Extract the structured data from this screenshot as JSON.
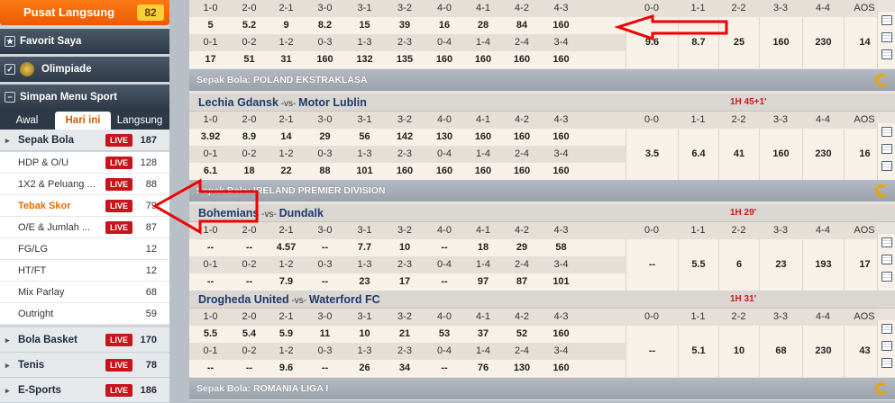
{
  "sidebar": {
    "live_label": "Pusat Langsung",
    "live_count": "82",
    "favorit": "Favorit Saya",
    "olimpiade": "Olimpiade",
    "simpan": "Simpan Menu Sport",
    "tabs": [
      "Awal",
      "Hari ini",
      "Langsung"
    ],
    "live_badge": "LIVE",
    "sports_top": {
      "label": "Sepak Bola",
      "count": "187"
    },
    "subs": [
      {
        "label": "HDP & O/U",
        "count": "128",
        "live": true
      },
      {
        "label": "1X2 & Peluang ...",
        "count": "88",
        "live": true
      },
      {
        "label": "Tebak Skor",
        "count": "79",
        "live": true
      },
      {
        "label": "O/E & Jumlah ...",
        "count": "87",
        "live": true
      },
      {
        "label": "FG/LG",
        "count": "12",
        "live": false
      },
      {
        "label": "HT/FT",
        "count": "12",
        "live": false
      },
      {
        "label": "Mix Parlay",
        "count": "68",
        "live": false
      },
      {
        "label": "Outright",
        "count": "59",
        "live": false
      }
    ],
    "sports_bottom": [
      {
        "label": "Bola Basket",
        "count": "170"
      },
      {
        "label": "Tenis",
        "count": "78"
      },
      {
        "label": "E-Sports",
        "count": "186"
      }
    ]
  },
  "score_headers": {
    "left": [
      "1-0",
      "2-0",
      "2-1",
      "3-0",
      "3-1",
      "3-2",
      "4-0",
      "4-1",
      "4-2",
      "4-3"
    ],
    "left_rev": [
      "0-1",
      "0-2",
      "1-2",
      "0-3",
      "1-3",
      "2-3",
      "0-4",
      "1-4",
      "2-4",
      "3-4"
    ],
    "right": [
      "0-0",
      "1-1",
      "2-2",
      "3-3",
      "4-4",
      "AOS"
    ]
  },
  "top_partial": {
    "rows": [
      [
        "5",
        "5.2",
        "9",
        "8.2",
        "15",
        "39",
        "16",
        "28",
        "84",
        "160"
      ],
      [
        "17",
        "51",
        "31",
        "160",
        "132",
        "135",
        "160",
        "160",
        "160",
        "160"
      ]
    ],
    "right": [
      "9.6",
      "8.7",
      "25",
      "160",
      "230",
      "14"
    ]
  },
  "leagues": [
    {
      "label": "Sepak Bola: POLAND EKSTRAKLASA"
    },
    {
      "label": "Sepak Bola: IRELAND PREMIER DIVISION"
    },
    {
      "label": "Sepak Bola: ROMANIA LIGA I"
    }
  ],
  "matches": [
    {
      "home": "Lechia Gdansk",
      "vs": "-vs-",
      "away": "Motor Lublin",
      "time": "1H 45+1'",
      "row1": [
        "3.92",
        "8.9",
        "14",
        "29",
        "56",
        "142",
        "130",
        "160",
        "160",
        "160"
      ],
      "row2": [
        "6.1",
        "18",
        "22",
        "88",
        "101",
        "160",
        "160",
        "160",
        "160",
        "160"
      ],
      "right": [
        "3.5",
        "6.4",
        "41",
        "160",
        "230",
        "16"
      ]
    },
    {
      "home": "Bohemians",
      "vs": "-vs-",
      "away": "Dundalk",
      "time": "1H 29'",
      "row1": [
        "--",
        "--",
        "4.57",
        "--",
        "7.7",
        "10",
        "--",
        "18",
        "29",
        "58"
      ],
      "row2": [
        "--",
        "--",
        "7.9",
        "--",
        "23",
        "17",
        "--",
        "97",
        "87",
        "101"
      ],
      "right": [
        "--",
        "5.5",
        "6",
        "23",
        "193",
        "17"
      ]
    },
    {
      "home": "Drogheda United",
      "vs": "-vs-",
      "away": "Waterford FC",
      "time": "1H 31'",
      "row1": [
        "5.5",
        "5.4",
        "5.9",
        "11",
        "10",
        "21",
        "53",
        "37",
        "52",
        "160"
      ],
      "row2": [
        "--",
        "--",
        "9.6",
        "--",
        "26",
        "34",
        "--",
        "76",
        "130",
        "160"
      ],
      "right": [
        "--",
        "5.1",
        "10",
        "68",
        "230",
        "43"
      ]
    }
  ]
}
